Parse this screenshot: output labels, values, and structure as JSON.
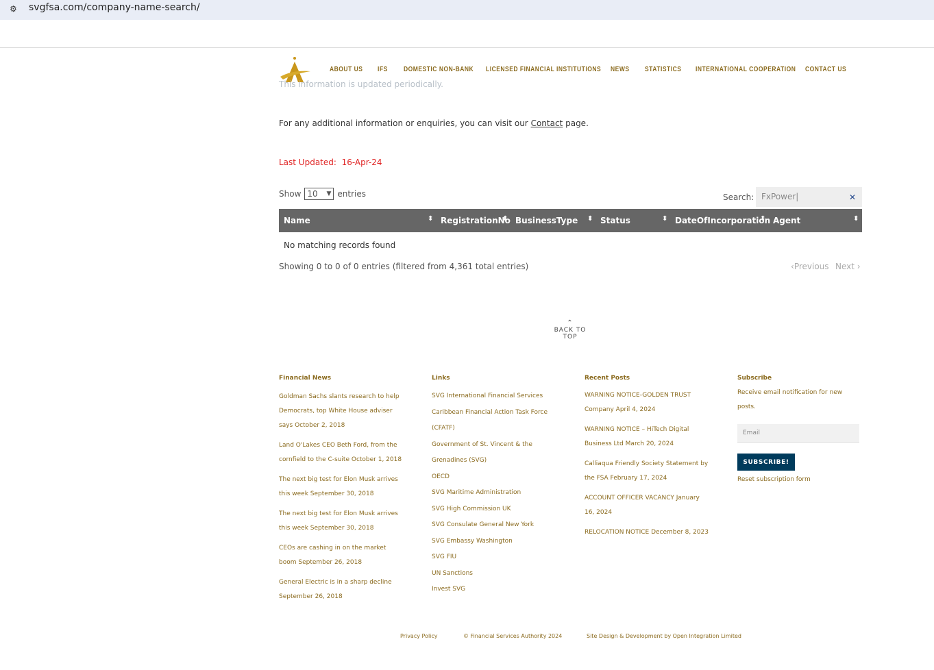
{
  "browser": {
    "url": "svgfsa.com/company-name-search/"
  },
  "nav": {
    "items": [
      "ABOUT US",
      "IFS",
      "DOMESTIC NON-BANK",
      "LICENSED FINANCIAL INSTITUTIONS",
      "NEWS",
      "STATISTICS",
      "INTERNATIONAL COOPERATION",
      "CONTACT US"
    ]
  },
  "content": {
    "faded_text": "This information is updated periodically.",
    "info_prefix": "For any additional information or enquiries, you can visit our",
    "info_link": "Contact",
    "info_suffix": "page.",
    "last_updated_label": "Last Updated:",
    "last_updated_value": "16-Apr-24"
  },
  "table": {
    "show_label": "Show",
    "page_size": "10",
    "entries_label": "entries",
    "search_label": "Search:",
    "search_value": "FxPower",
    "columns": [
      "Name",
      "RegistrationNo",
      "BusinessType",
      "Status",
      "DateOfIncorporation",
      "Agent"
    ],
    "empty": "No matching records found",
    "info": "Showing 0 to 0 of 0 entries (filtered from 4,361 total entries)",
    "previous": "Previous",
    "next": "Next"
  },
  "back_to_top": "BACK TO TOP",
  "footer": {
    "news_title": "Financial News",
    "news": [
      "Goldman Sachs slants research to help",
      "Democrats, top White House adviser",
      "says October 2, 2018",
      "Land O'Lakes CEO Beth Ford, from the",
      "cornfield to the C-suite October 1, 2018",
      "The next big test for Elon Musk arrives",
      "this week September 30, 2018",
      "The next big test for Elon Musk arrives",
      "this week September 30, 2018",
      "CEOs are cashing in on the market",
      "boom September 26, 2018",
      "General Electric is in a sharp decline",
      "September 26, 2018"
    ],
    "links_title": "Links",
    "links": [
      "SVG International Financial Services",
      "Caribbean Financial Action Task Force",
      "(CFATF)",
      "Government of St. Vincent & the",
      "Grenadines (SVG)",
      "OECD",
      "SVG Maritime Administration",
      "SVG High Commission UK",
      "SVG Consulate General New York",
      "SVG Embassy Washington",
      "SVG FIU",
      "UN Sanctions",
      "Invest SVG"
    ],
    "posts_title": "Recent Posts",
    "posts": [
      "WARNING NOTICE-GOLDEN TRUST",
      "Company April 4, 2024",
      "WARNING NOTICE – HiTech Digital",
      "Business Ltd March 20, 2024",
      "Calliaqua Friendly Society Statement by",
      "the FSA February 17, 2024",
      "ACCOUNT OFFICER VACANCY January",
      "16, 2024",
      "RELOCATION NOTICE December 8, 2023"
    ],
    "subscribe_title": "Subscribe",
    "subscribe_text1": "Receive email notification for new",
    "subscribe_text2": "posts.",
    "email_placeholder": "Email",
    "subscribe_button": "SUBSCRIBE!",
    "reset": "Reset subscription form",
    "privacy": "Privacy Policy",
    "copyright": "© Financial Services Authority 2024",
    "credit": "Site Design & Development by Open Integration Limited"
  }
}
